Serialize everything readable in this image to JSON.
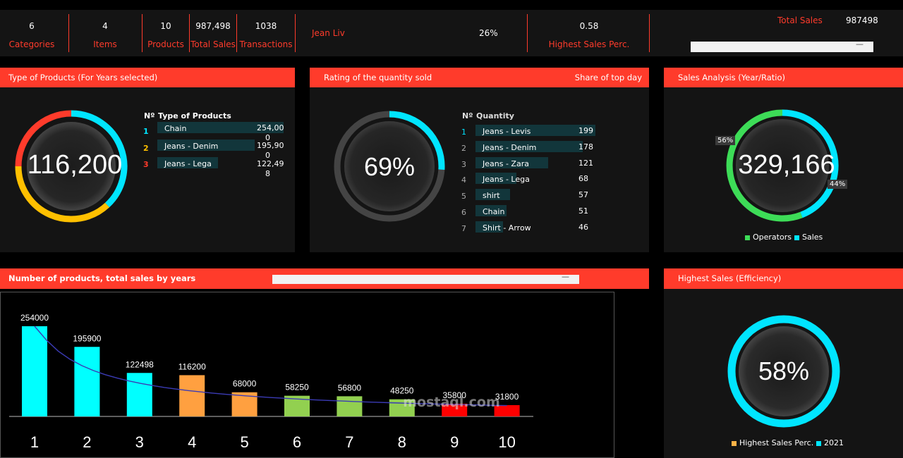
{
  "kpis": [
    {
      "value": "6",
      "label": "Categories"
    },
    {
      "value": "4",
      "label": "Items"
    },
    {
      "value": "10",
      "label": "Products"
    },
    {
      "value": "987,498",
      "label": "Total Sales"
    },
    {
      "value": "1038",
      "label": "Transactions"
    }
  ],
  "top_seller": {
    "name": "Jean Liv",
    "percent": "26%"
  },
  "highest": {
    "value": "0.58",
    "label": "Highest Sales Perc."
  },
  "total_sales": {
    "label": "Total Sales",
    "value": "987498",
    "dash": "—"
  },
  "panel1": {
    "title": "Type of Products (For Years selected)",
    "center": "116,200",
    "col_no": "Nº",
    "col_name": "Type of Products",
    "rows": [
      {
        "no": "1",
        "name": "Chain",
        "v1": "254,00",
        "v2": "0",
        "color": "#00e5ff"
      },
      {
        "no": "2",
        "name": "Jeans - Denim",
        "v1": "195,90",
        "v2": "0",
        "color": "#ffc000"
      },
      {
        "no": "3",
        "name": "Jeans - Lega",
        "v1": "122,49",
        "v2": "8",
        "color": "#ff3b2b"
      }
    ]
  },
  "panel2": {
    "title": "Rating of the quantity sold",
    "title_right": "Share of top day",
    "center": "69%",
    "gauge_fraction": 0.26,
    "col_no": "Nº",
    "col_name": "Quantity",
    "rows": [
      {
        "no": "1",
        "name": "Jeans - Levis",
        "qty": "199"
      },
      {
        "no": "2",
        "name": "Jeans - Denim",
        "qty": "178"
      },
      {
        "no": "3",
        "name": "Jeans - Zara",
        "qty": "121"
      },
      {
        "no": "4",
        "name": "Jeans - Lega",
        "qty": "68"
      },
      {
        "no": "5",
        "name": "shirt",
        "qty": "57"
      },
      {
        "no": "6",
        "name": "Chain",
        "qty": "51"
      },
      {
        "no": "7",
        "name": "Shirt - Arrow",
        "qty": "46"
      }
    ]
  },
  "panel3": {
    "title": "Sales Analysis (Year/Ratio)",
    "center": "329,166",
    "pct_left": "56%",
    "pct_right": "44%",
    "legend": [
      {
        "label": "Operators",
        "color": "#3ddc57"
      },
      {
        "label": "Sales",
        "color": "#00e5ff"
      }
    ]
  },
  "panel4": {
    "title": "Number of products, total sales by years",
    "dash": "—"
  },
  "panel5": {
    "title": "Highest Sales (Efficiency)",
    "center": "58%",
    "legend": [
      {
        "label": "Highest Sales Perc.",
        "color": "#ffb347"
      },
      {
        "label": "2021",
        "color": "#00e5ff"
      }
    ]
  },
  "chart_data": {
    "type": "bar",
    "categories": [
      "1",
      "2",
      "3",
      "4",
      "5",
      "6",
      "7",
      "8",
      "9",
      "10"
    ],
    "values": [
      254000,
      195900,
      122498,
      116200,
      68000,
      58250,
      56800,
      48250,
      35800,
      31800
    ],
    "colors": [
      "#00ffff",
      "#00ffff",
      "#00ffff",
      "#ffa040",
      "#ffa040",
      "#92d050",
      "#92d050",
      "#92d050",
      "#ff0000",
      "#ff0000"
    ],
    "trendline": true,
    "title": "",
    "xlabel": "",
    "ylabel": "",
    "ylim": [
      0,
      254000
    ]
  },
  "watermark": "mostaql.com"
}
